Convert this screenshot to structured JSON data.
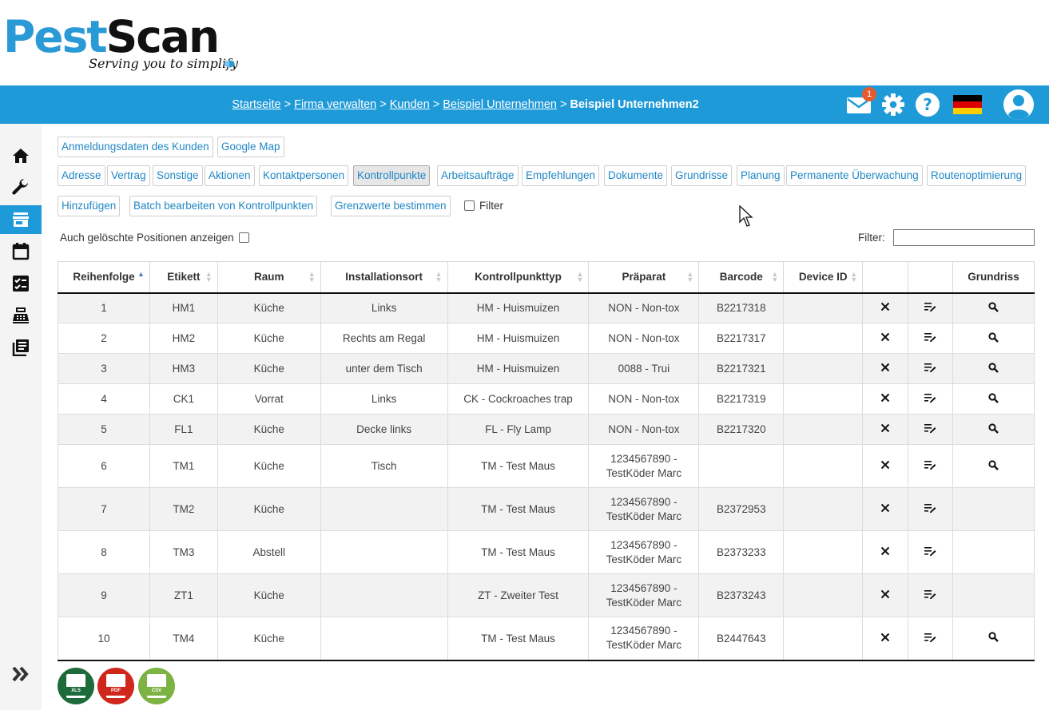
{
  "logo": {
    "pest": "Pest",
    "scan": "Scan",
    "tagline": "Serving you to simplify"
  },
  "breadcrumb": {
    "items": [
      "Startseite",
      "Firma verwalten",
      "Kunden",
      "Beispiel Unternehmen"
    ],
    "current": "Beispiel Unternehmen2",
    "separator": " > "
  },
  "nav": {
    "mail_badge": "1",
    "icons": [
      "mail-icon",
      "gear-icon",
      "help-icon",
      "german-flag-icon",
      "user-avatar-icon"
    ]
  },
  "sidebar": {
    "items": [
      "home-icon",
      "wrench-icon",
      "store-icon",
      "calendar-icon",
      "checklist-icon",
      "cash-register-icon",
      "library-icon"
    ],
    "active_index": 2,
    "expand_icon": "double-chevron-right-icon"
  },
  "toolbar": {
    "row1": [
      "Anmeldungsdaten des Kunden",
      "Google Map"
    ],
    "tabs": [
      "Adresse",
      "Vertrag",
      "Sonstige",
      "Aktionen",
      "Kontaktpersonen",
      "Kontrollpunkte",
      "Arbeitsaufträge",
      "Empfehlungen",
      "Dokumente",
      "Grundrisse",
      "Planung",
      "Permanente Überwachung",
      "Routenoptimierung"
    ],
    "active_tab": "Kontrollpunkte",
    "actions": [
      "Hinzufügen",
      "Batch bearbeiten von Kontrollpunkten",
      "Grenzwerte bestimmen"
    ],
    "filter_checkbox_label": "Filter",
    "show_deleted_label": "Auch gelöschte Positionen anzeigen",
    "filter_label": "Filter:",
    "filter_value": ""
  },
  "table": {
    "columns": [
      "Reihenfolge",
      "Etikett",
      "Raum",
      "Installationsort",
      "Kontrollpunkttyp",
      "Präparat",
      "Barcode",
      "Device ID",
      "",
      "",
      "Grundriss"
    ],
    "rows": [
      {
        "order": "1",
        "label": "HM1",
        "room": "Küche",
        "location": "Links",
        "type": "HM - Huismuizen",
        "prep1": "NON - Non-tox",
        "prep2": "",
        "barcode": "B2217318",
        "device": "",
        "plan": true
      },
      {
        "order": "2",
        "label": "HM2",
        "room": "Küche",
        "location": "Rechts am Regal",
        "type": "HM - Huismuizen",
        "prep1": "NON - Non-tox",
        "prep2": "",
        "barcode": "B2217317",
        "device": "",
        "plan": true
      },
      {
        "order": "3",
        "label": "HM3",
        "room": "Küche",
        "location": "unter dem Tisch",
        "type": "HM - Huismuizen",
        "prep1": "0088 - Trui",
        "prep2": "",
        "barcode": "B2217321",
        "device": "",
        "plan": true
      },
      {
        "order": "4",
        "label": "CK1",
        "room": "Vorrat",
        "location": "Links",
        "type": "CK - Cockroaches trap",
        "prep1": "NON - Non-tox",
        "prep2": "",
        "barcode": "B2217319",
        "device": "",
        "plan": true
      },
      {
        "order": "5",
        "label": "FL1",
        "room": "Küche",
        "location": "Decke links",
        "type": "FL - Fly Lamp",
        "prep1": "NON - Non-tox",
        "prep2": "",
        "barcode": "B2217320",
        "device": "",
        "plan": true
      },
      {
        "order": "6",
        "label": "TM1",
        "room": "Küche",
        "location": "Tisch",
        "type": "TM - Test Maus",
        "prep1": "1234567890 -",
        "prep2": "TestKöder Marc",
        "barcode": "",
        "device": "",
        "plan": true
      },
      {
        "order": "7",
        "label": "TM2",
        "room": "Küche",
        "location": "",
        "type": "TM - Test Maus",
        "prep1": "1234567890 -",
        "prep2": "TestKöder Marc",
        "barcode": "B2372953",
        "device": "",
        "plan": false
      },
      {
        "order": "8",
        "label": "TM3",
        "room": "Abstell",
        "location": "",
        "type": "TM - Test Maus",
        "prep1": "1234567890 -",
        "prep2": "TestKöder Marc",
        "barcode": "B2373233",
        "device": "",
        "plan": false
      },
      {
        "order": "9",
        "label": "ZT1",
        "room": "Küche",
        "location": "",
        "type": "ZT - Zweiter Test",
        "prep1": "1234567890 -",
        "prep2": "TestKöder Marc",
        "barcode": "B2373243",
        "device": "",
        "plan": false
      },
      {
        "order": "10",
        "label": "TM4",
        "room": "Küche",
        "location": "",
        "type": "TM - Test Maus",
        "prep1": "1234567890 -",
        "prep2": "TestKöder Marc",
        "barcode": "B2447643",
        "device": "",
        "plan": true
      }
    ],
    "row_icons": [
      "delete-icon",
      "edit-icon",
      "magnifier-icon"
    ]
  },
  "exports": [
    {
      "label": "XLS",
      "color": "#1d6b3a"
    },
    {
      "label": "PDF",
      "color": "#d0271d"
    },
    {
      "label": "CSV",
      "color": "#7cb342"
    }
  ],
  "colors": {
    "brand_blue": "#1f9ad8",
    "link_blue": "#1f87c4",
    "badge": "#e25c30"
  }
}
